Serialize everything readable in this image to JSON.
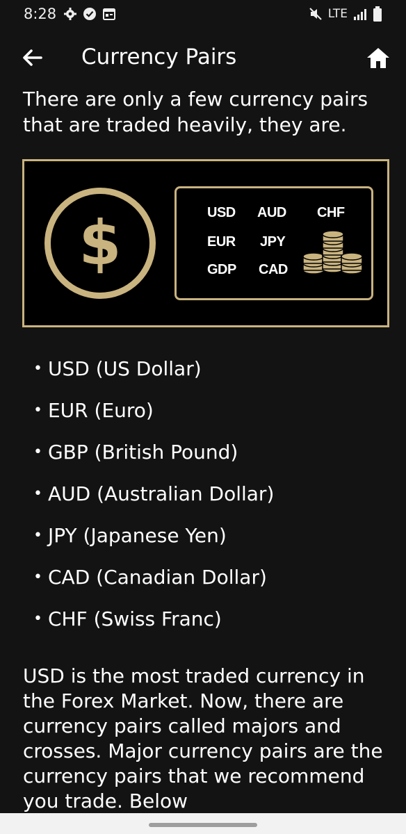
{
  "status_bar": {
    "time": "8:28",
    "network": "LTE",
    "left_icons": [
      "gear-icon",
      "check-circle-icon",
      "calendar-icon"
    ],
    "right_icons": [
      "mute-icon",
      "signal-icon",
      "battery-icon"
    ]
  },
  "app_bar": {
    "title": "Currency Pairs",
    "back_icon": "arrow-left-icon",
    "home_icon": "home-icon"
  },
  "intro_text": "There are only a few currency pairs that are traded heavily, they are.",
  "banner": {
    "symbol": "$",
    "codes": [
      "USD",
      "AUD",
      "CHF",
      "EUR",
      "JPY",
      "GDP",
      "CAD"
    ],
    "accent_color": "#c9b37f"
  },
  "currencies": [
    "USD (US Dollar)",
    "EUR (Euro)",
    "GBP (British Pound)",
    "AUD (Australian Dollar)",
    "JPY (Japanese Yen)",
    "CAD (Canadian Dollar)",
    "CHF (Swiss Franc)"
  ],
  "bullet": "•",
  "body_paragraph": "USD is the most traded currency in the Forex Market. Now, there are currency pairs called majors and crosses. Major currency pairs are the currency pairs that we recommend you trade. Below",
  "colors": {
    "background": "#131313",
    "text": "#ffffff",
    "gold": "#c9b37f"
  }
}
